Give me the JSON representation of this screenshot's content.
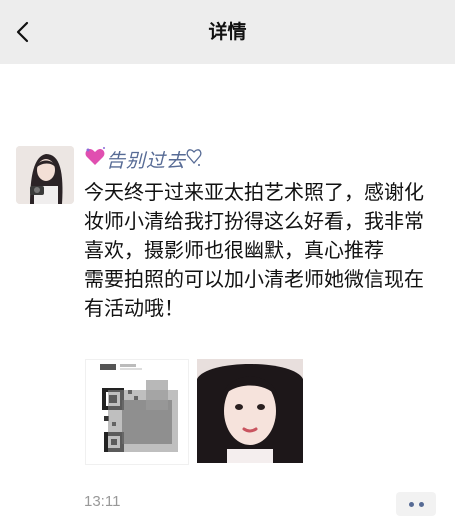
{
  "navbar": {
    "title": "详情",
    "back_icon": "chevron-left-icon"
  },
  "post": {
    "author": {
      "nickname": "告别过去",
      "decor_left_icon": "sparkle-heart-icon",
      "decor_right_icon": "heart-outline-icon"
    },
    "text": "今天终于过来亚太拍艺术照了，感谢化妆师小清给我打扮得这么好看，我非常喜欢，摄影师也很幽默，真心推荐\n需要拍照的可以加小清老师她微信现在有活动哦！",
    "images": [
      {
        "kind": "qr-code-screenshot"
      },
      {
        "kind": "portrait-photo"
      }
    ],
    "time": "13:11",
    "more_icon": "more-dots-icon"
  }
}
